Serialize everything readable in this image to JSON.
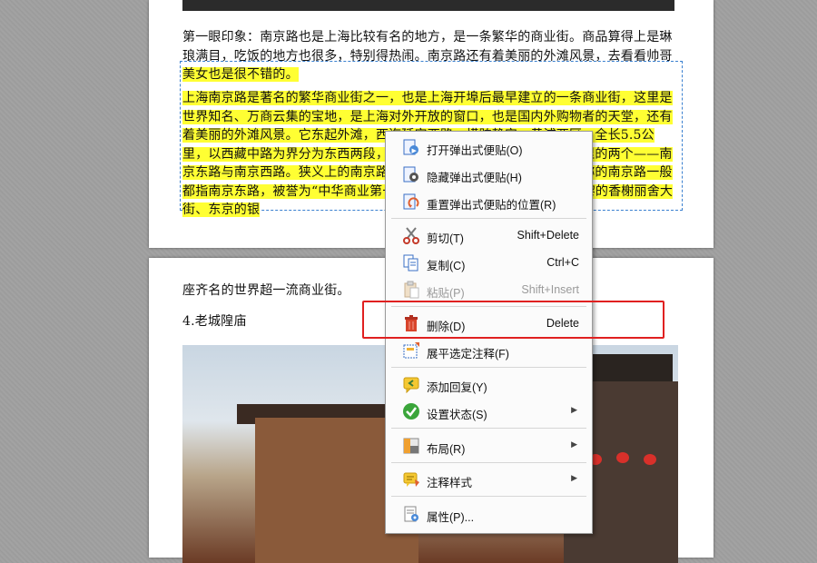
{
  "document": {
    "para1_plain": "第一眼印象：南京路也是上海比较有名的地方，是一条繁华的商业街。商品算得上是琳琅满目，吃饭的地方也很多，特别得热闹。南京路还有着美丽的外滩风景，去看看帅哥",
    "para1_highlight": "美女也是很不错的。",
    "para2_highlight": "上海南京路是著名的繁华商业街之一，也是上海开埠后最早建立的一条商业街，这里是世界知名、万商云集的宝地，是上海对外开放的窗口，也是国内外购物者的天堂，还有着美丽的外滩风景。它东起外滩，西迄延安西路，横跨静安、黄浦两区，全长5.5公里，以西藏中路为界分为东西两段，现在的南京东路是上海的商业中心里的两个——南京东路与南京西路。狭义上的南京路是指今天的南京东路。上海当地所称的南京路一般都指南京东路，被誉为“中华商业第一街”，它是与纽约的第五大道、巴黎的香榭丽舍大街、东京的银",
    "para3": "座齐名的世界超一流商业街。",
    "heading4": "4.老城隍庙"
  },
  "context_menu": {
    "items": [
      {
        "label": "打开弹出式便贴(O)",
        "shortcut": "",
        "icon": "popup-note-open-icon",
        "disabled": false
      },
      {
        "label": "隐藏弹出式便贴(H)",
        "shortcut": "",
        "icon": "popup-note-hide-icon",
        "disabled": false
      },
      {
        "label": "重置弹出式便贴的位置(R)",
        "shortcut": "",
        "icon": "popup-note-reset-icon",
        "disabled": false
      },
      {
        "label": "剪切(T)",
        "shortcut": "Shift+Delete",
        "icon": "scissors-icon",
        "disabled": false
      },
      {
        "label": "复制(C)",
        "shortcut": "Ctrl+C",
        "icon": "copy-icon",
        "disabled": false
      },
      {
        "label": "粘贴(P)",
        "shortcut": "Shift+Insert",
        "icon": "paste-icon",
        "disabled": true
      },
      {
        "label": "删除(D)",
        "shortcut": "Delete",
        "icon": "trash-icon",
        "disabled": false
      },
      {
        "label": "展平选定注释(F)",
        "shortcut": "",
        "icon": "flatten-icon",
        "disabled": false
      },
      {
        "label": "添加回复(Y)",
        "shortcut": "",
        "icon": "reply-icon",
        "disabled": false
      },
      {
        "label": "设置状态(S)",
        "shortcut": "",
        "icon": "status-check-icon",
        "disabled": false
      },
      {
        "label": "布局(R)",
        "shortcut": "",
        "icon": "layout-icon",
        "disabled": false
      },
      {
        "label": "注释样式",
        "shortcut": "",
        "icon": "comment-style-icon",
        "disabled": false
      },
      {
        "label": "属性(P)...",
        "shortcut": "",
        "icon": "properties-icon",
        "disabled": false
      }
    ]
  },
  "colors": {
    "highlight": "#ffff33",
    "emphasis_box": "#e02020",
    "trash": "#d8452c"
  }
}
